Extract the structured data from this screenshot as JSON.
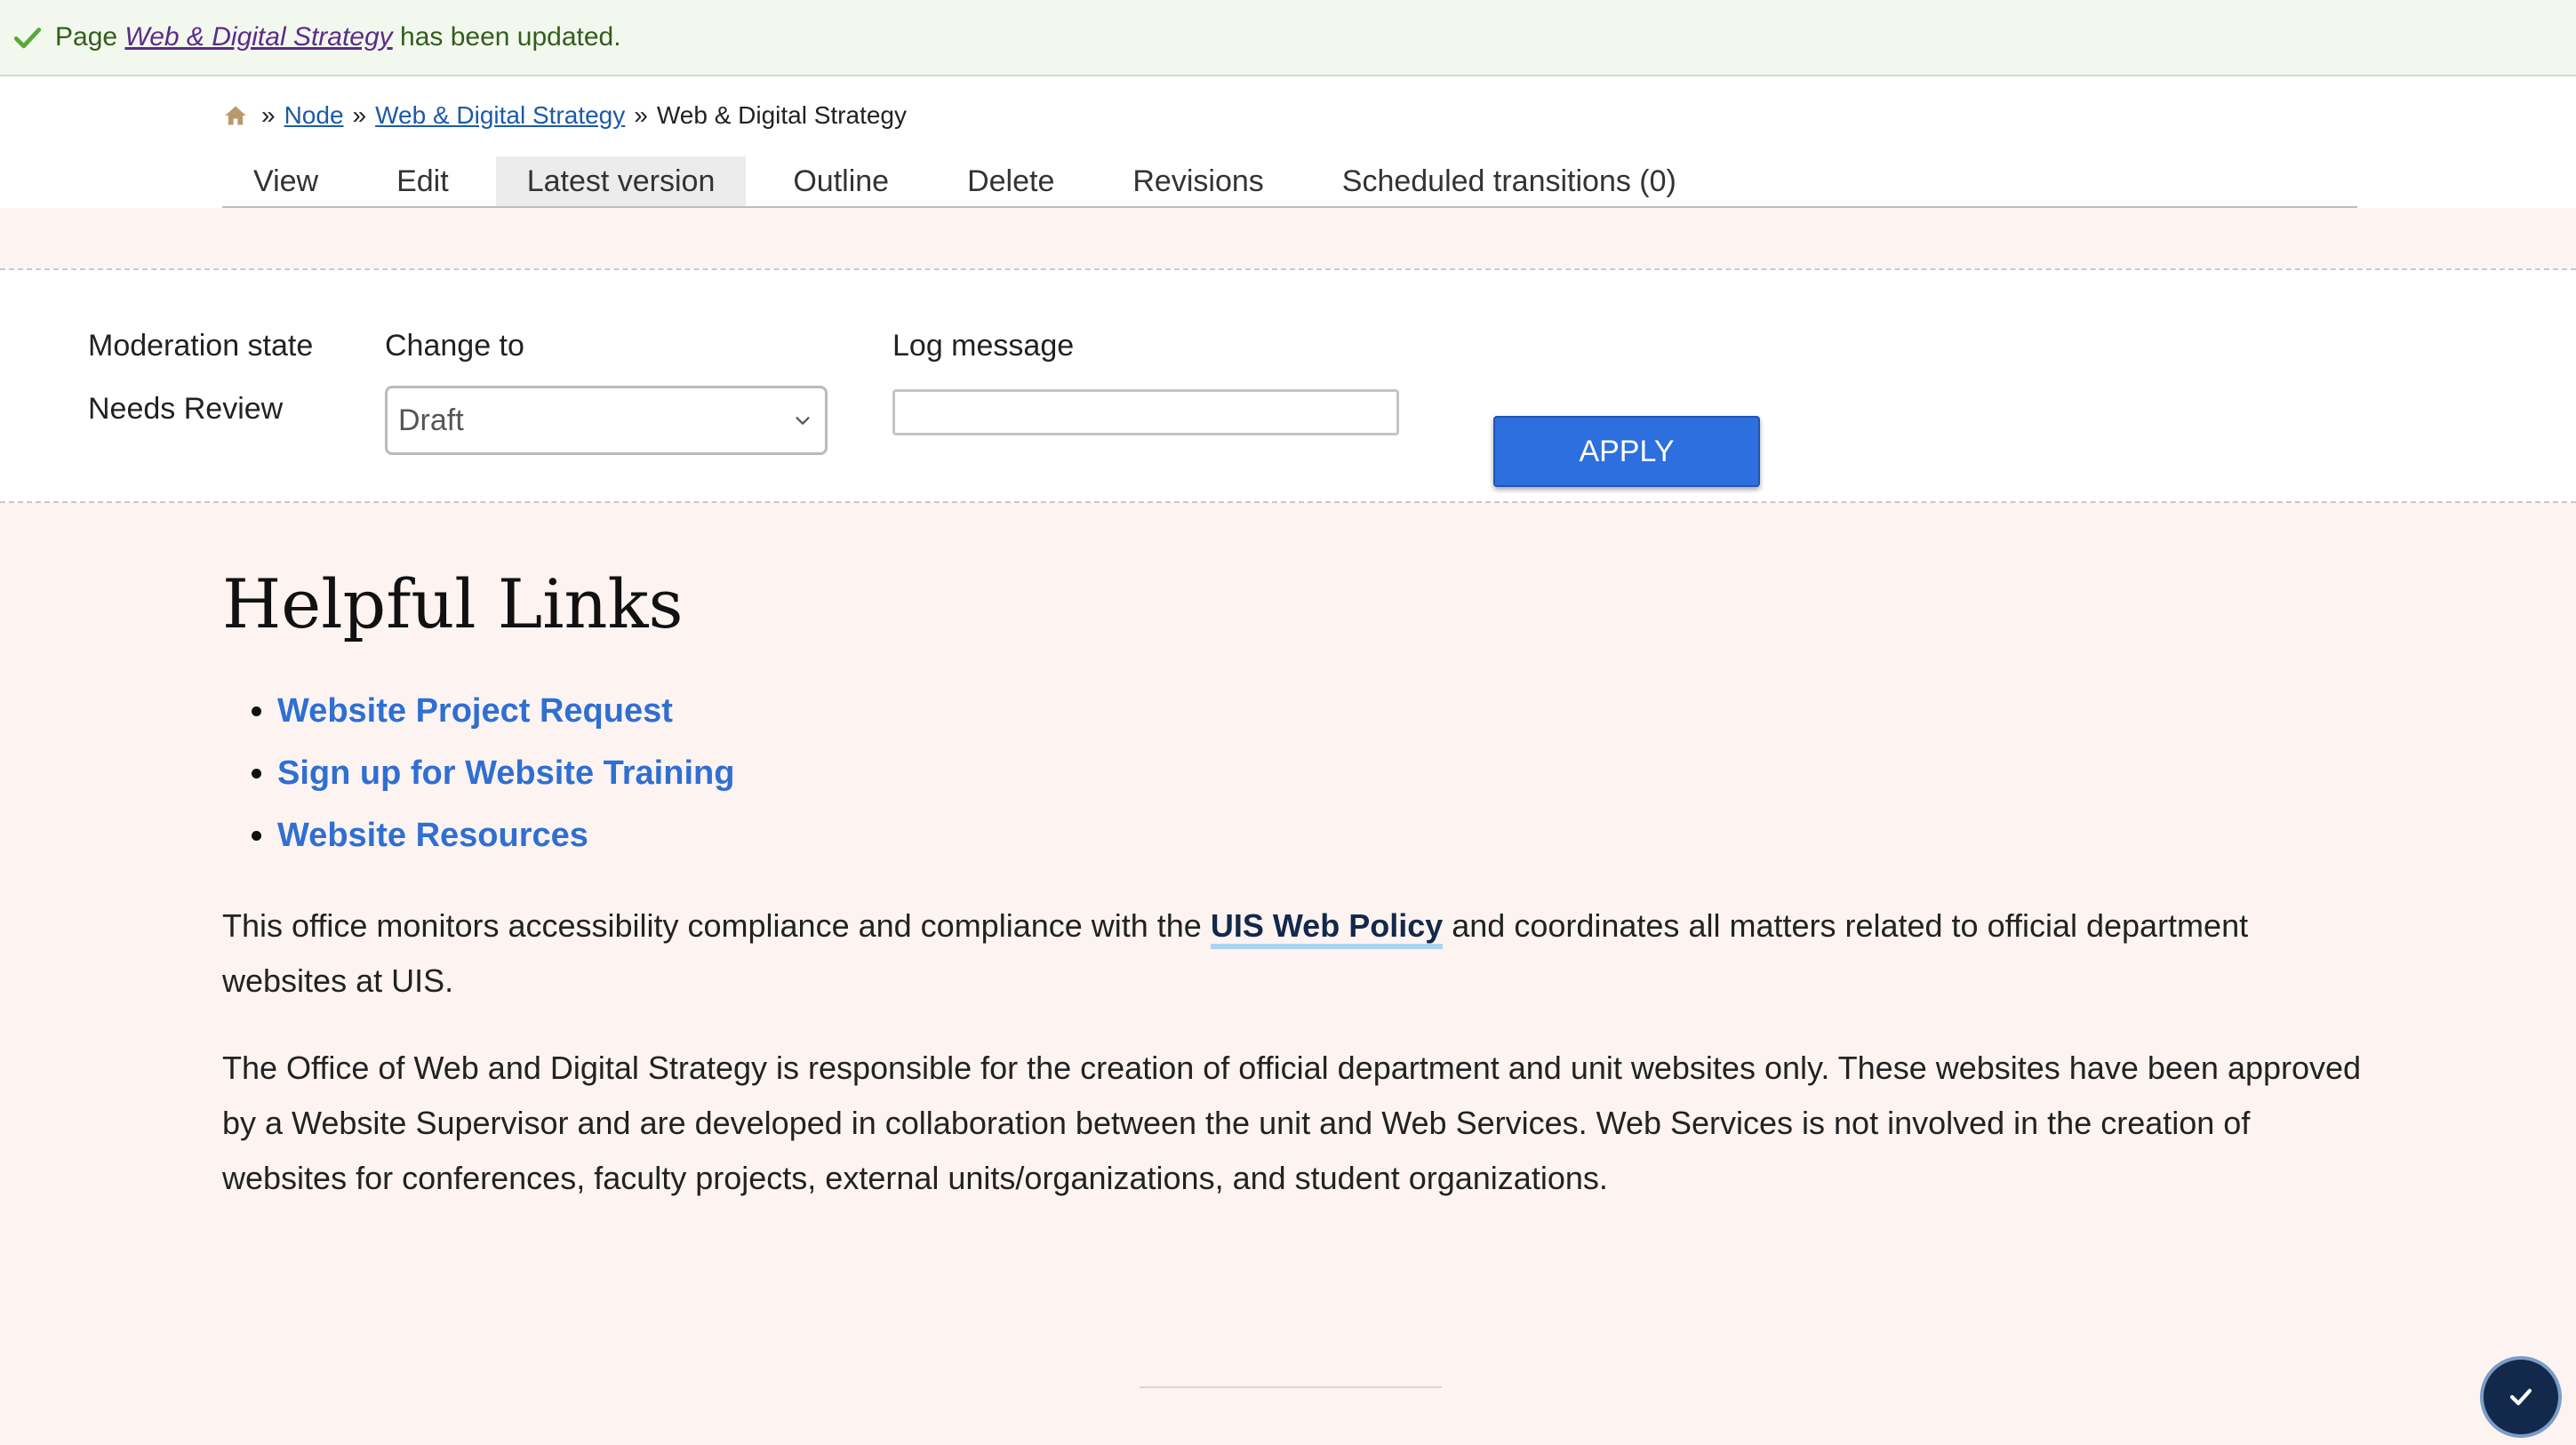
{
  "status": {
    "prefix": "Page",
    "link_text": "Web & Digital Strategy",
    "suffix": "has been updated."
  },
  "breadcrumb": {
    "separator": "»",
    "items": [
      "Node",
      "Web & Digital Strategy"
    ],
    "current": "Web & Digital Strategy"
  },
  "tabs": [
    {
      "label": "View"
    },
    {
      "label": "Edit"
    },
    {
      "label": "Latest version",
      "active": true
    },
    {
      "label": "Outline"
    },
    {
      "label": "Delete"
    },
    {
      "label": "Revisions"
    },
    {
      "label": "Scheduled transitions (0)"
    }
  ],
  "moderation": {
    "state_label": "Moderation state",
    "state_value": "Needs Review",
    "change_to_label": "Change to",
    "change_to_value": "Draft",
    "log_label": "Log message",
    "log_value": "",
    "apply_label": "APPLY"
  },
  "content": {
    "title": "Helpful Links",
    "links": [
      "Website Project Request",
      "Sign up for Website Training",
      "Website Resources"
    ],
    "para1_before": "This office monitors accessibility compliance and compliance with the ",
    "para1_link": "UIS Web Policy",
    "para1_after": " and coordinates all matters related to official department websites at UIS.",
    "para2": "The Office of Web and Digital Strategy is responsible for the creation of official department and unit websites only. These websites have been approved by a Website Supervisor and are developed in collaboration between the unit and Web Services. Web Services is not involved in the creation of websites for conferences, faculty projects, external units/organizations, and student organizations."
  },
  "colors": {
    "accent": "#2d6fde",
    "link": "#2f6fd2",
    "status_bg": "#f3f8ee",
    "page_bg": "#fdf3f1"
  },
  "icons": {
    "status": "check-icon",
    "home": "home-icon",
    "select": "chevron-down-icon",
    "fab": "checkmark-icon"
  }
}
